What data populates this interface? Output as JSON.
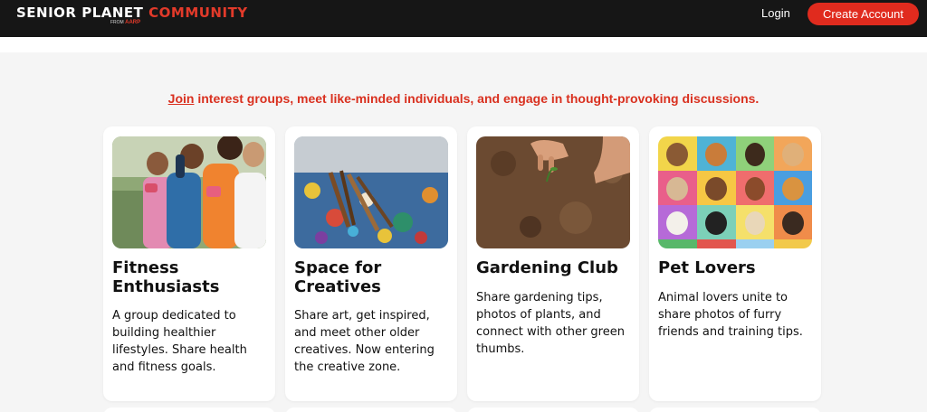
{
  "header": {
    "logo_white": "SENIOR PLANET",
    "logo_red": "COMMUNITY",
    "logo_sub_from": "FROM",
    "logo_sub_brand": "AARP",
    "login_label": "Login",
    "create_account_label": "Create Account"
  },
  "tagline": {
    "join": "Join",
    "rest": " interest groups, meet like-minded individuals, and engage in thought-provoking discussions."
  },
  "groups": [
    {
      "title": "Fitness Enthusiasts",
      "description": "A group dedicated to building healthier lifestyles. Share health and fitness goals."
    },
    {
      "title": "Space for Creatives",
      "description": "Share art, get inspired, and meet other older creatives. Now entering the creative zone."
    },
    {
      "title": "Gardening Club",
      "description": "Share gardening tips, photos of plants, and connect with other green thumbs."
    },
    {
      "title": "Pet Lovers",
      "description": "Animal lovers unite to share photos of furry friends and training tips."
    }
  ],
  "colors": {
    "brand_red": "#e02b1e",
    "header_bg": "#161616"
  }
}
